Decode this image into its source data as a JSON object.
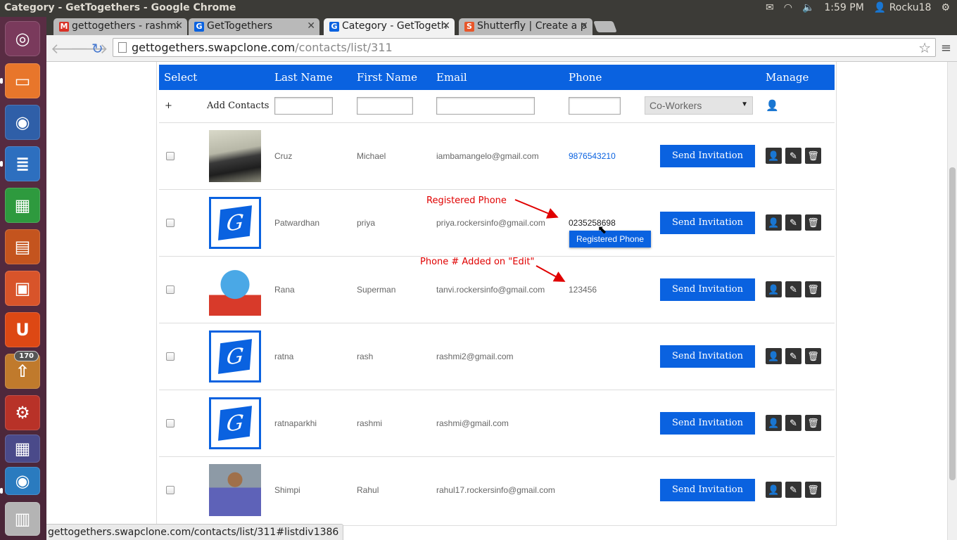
{
  "os": {
    "window_title": "Category - GetTogethers - Google Chrome",
    "time": "1:59 PM",
    "user": "Rocku18",
    "launcher_badge": "170"
  },
  "browser": {
    "tabs": [
      {
        "label": "gettogethers - rashmi",
        "favicon": "M",
        "favicon_color": "#d93025"
      },
      {
        "label": "GetTogethers",
        "favicon": "G",
        "favicon_color": "#0a62e0"
      },
      {
        "label": "Category - GetTogeth",
        "favicon": "G",
        "favicon_color": "#0a62e0"
      },
      {
        "label": "Shutterfly | Create a p",
        "favicon": "S",
        "favicon_color": "#e8562a"
      }
    ],
    "url_host": "gettogethers.swapclone.com",
    "url_path": "/contacts/list/311",
    "status_url": "gettogethers.swapclone.com/contacts/list/311#listdiv1386"
  },
  "table": {
    "headers": {
      "select": "Select",
      "last_name": "Last Name",
      "first_name": "First Name",
      "email": "Email",
      "phone": "Phone",
      "manage": "Manage"
    },
    "add_row": {
      "plus": "+",
      "label": "Add Contacts",
      "group_selected": "Co-Workers"
    },
    "invite_label": "Send Invitation",
    "rows": [
      {
        "last": "Cruz",
        "first": "Michael",
        "email": "iambamangelo@gmail.com",
        "phone": "9876543210",
        "avatar": "photo-car"
      },
      {
        "last": "Patwardhan",
        "first": "priya",
        "email": "priya.rockersinfo@gmail.com",
        "phone": "0235258698",
        "avatar": "logo"
      },
      {
        "last": "Rana",
        "first": "Superman",
        "email": "tanvi.rockersinfo@gmail.com",
        "phone": "123456",
        "avatar": "photo-bird"
      },
      {
        "last": "ratna",
        "first": "rash",
        "email": "rashmi2@gmail.com",
        "phone": "",
        "avatar": "logo"
      },
      {
        "last": "ratnaparkhi",
        "first": "rashmi",
        "email": "rashmi@gmail.com",
        "phone": "",
        "avatar": "logo"
      },
      {
        "last": "Shimpi",
        "first": "Rahul",
        "email": "rahul17.rockersinfo@gmail.com",
        "phone": "",
        "avatar": "photo-man"
      }
    ]
  },
  "annotations": {
    "registered_phone": "Registered Phone",
    "phone_added": "Phone # Added on \"Edit\"",
    "tooltip": "Registered Phone"
  },
  "colors": {
    "accent": "#0a62e0",
    "annotation": "#e00000"
  }
}
